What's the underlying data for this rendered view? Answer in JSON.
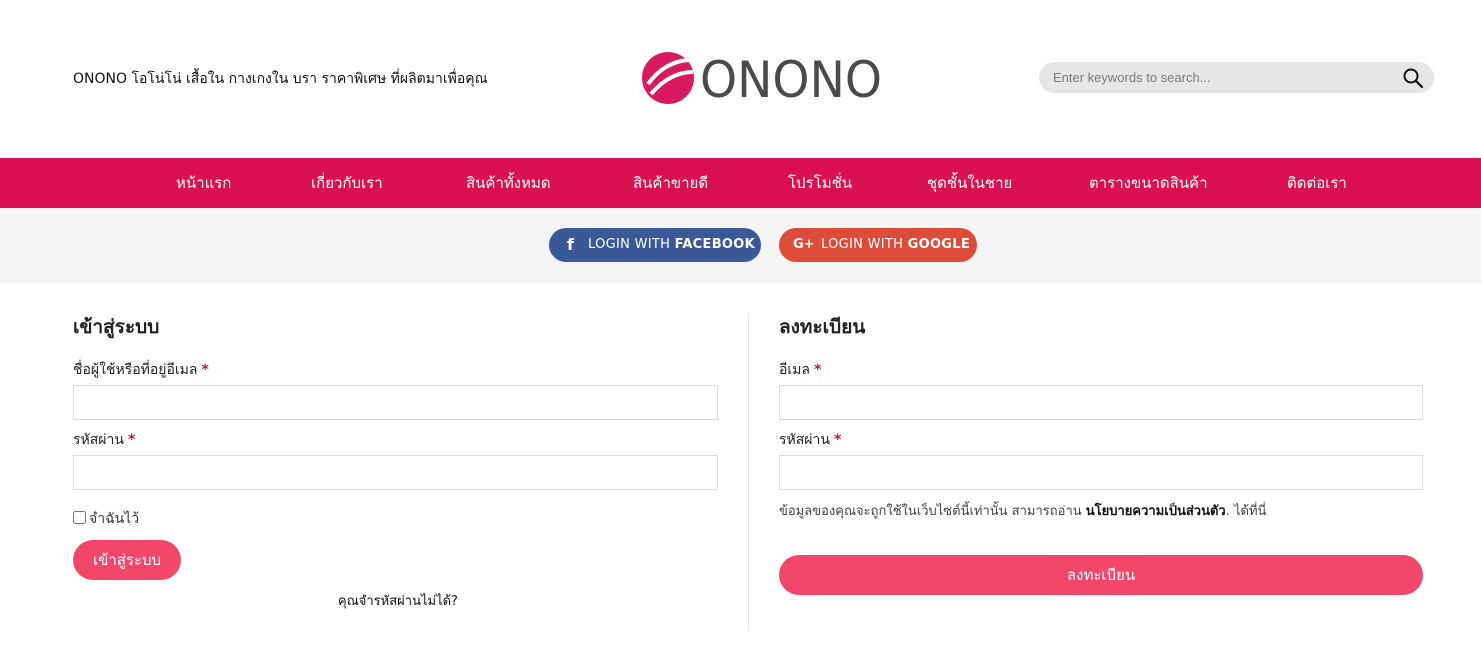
{
  "header": {
    "tagline": "ONONO โอโน่โน่ เสื้อใน กางเกงใน บรา ราคาพิเศษ ที่ผลิตมาเพื่อคุณ",
    "logo_text": "ONONO",
    "search_placeholder": "Enter keywords to search..."
  },
  "nav": {
    "items": [
      {
        "label": "หน้าแรก"
      },
      {
        "label": "เกี่ยวกับเรา"
      },
      {
        "label": "สินค้าทั้งหมด"
      },
      {
        "label": "สินค้าขายดี"
      },
      {
        "label": "โปรโมชั่น"
      },
      {
        "label": "ชุดชั้นในชาย"
      },
      {
        "label": "ตารางขนาดสินค้า"
      },
      {
        "label": "ติดต่อเรา"
      }
    ]
  },
  "social": {
    "facebook": {
      "prefix": "LOGIN WITH",
      "brand": "FACEBOOK",
      "icon": "facebook-icon"
    },
    "google": {
      "prefix": "LOGIN WITH",
      "brand": "GOOGLE",
      "icon": "google-plus-icon"
    }
  },
  "login": {
    "title": "เข้าสู่ระบบ",
    "username_label": "ชื่อผู้ใช้หรือที่อยู่อีเมล",
    "password_label": "รหัสผ่าน",
    "required_mark": "*",
    "remember_label": "จำฉันไว้",
    "submit_label": "เข้าสู่ระบบ",
    "forgot_label": "คุณจำรหัสผ่านไม่ได้?"
  },
  "register": {
    "title": "ลงทะเบียน",
    "email_label": "อีเมล",
    "password_label": "รหัสผ่าน",
    "required_mark": "*",
    "privacy_before": "ข้อมูลของคุณจะถูกใช้ในเว็บไซต์นี้เท่านั้น สามารถอ่าน ",
    "privacy_link": "นโยบายความเป็นส่วนตัว",
    "privacy_after": ". ได้ที่นี่",
    "submit_label": "ลงทะเบียน"
  },
  "colors": {
    "nav_bg": "#d91052",
    "button_pink": "#f3466b",
    "facebook": "#3b5998",
    "google": "#dd4b39",
    "logo_accent": "#d81b60",
    "logo_text": "#4a4a4a"
  }
}
